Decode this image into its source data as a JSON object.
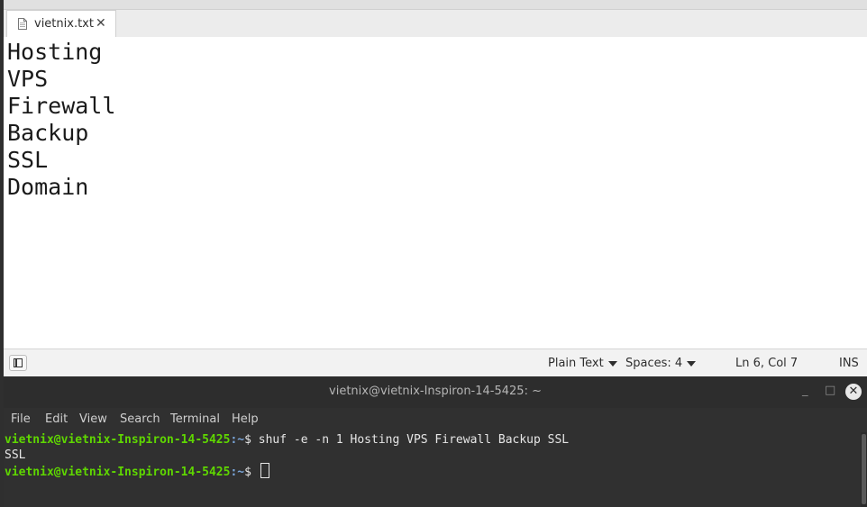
{
  "editor": {
    "tab": {
      "file_name": "vietnix.txt",
      "close_glyph": "✕"
    },
    "lines": [
      "Hosting",
      "VPS",
      "Firewall",
      "Backup",
      "SSL",
      "Domain"
    ],
    "status": {
      "language": "Plain Text",
      "indent": "Spaces: 4",
      "position": "Ln 6, Col 7",
      "mode": "INS"
    }
  },
  "terminal": {
    "title": "vietnix@vietnix-Inspiron-14-5425: ~",
    "window_buttons": {
      "minimize": "_",
      "maximize": "□",
      "close": "✕"
    },
    "menu": [
      "File",
      "Edit",
      "View",
      "Search",
      "Terminal",
      "Help"
    ],
    "prompt_user": "vietnix@vietnix-Inspiron-14-5425",
    "prompt_path": ":~",
    "prompt_symbol": "$ ",
    "command": "shuf -e -n 1 Hosting VPS Firewall Backup SSL",
    "output": "SSL"
  },
  "colors": {
    "prompt_user": "#5fd700",
    "prompt_path": "#7aa6da",
    "terminal_bg": "#303030"
  }
}
